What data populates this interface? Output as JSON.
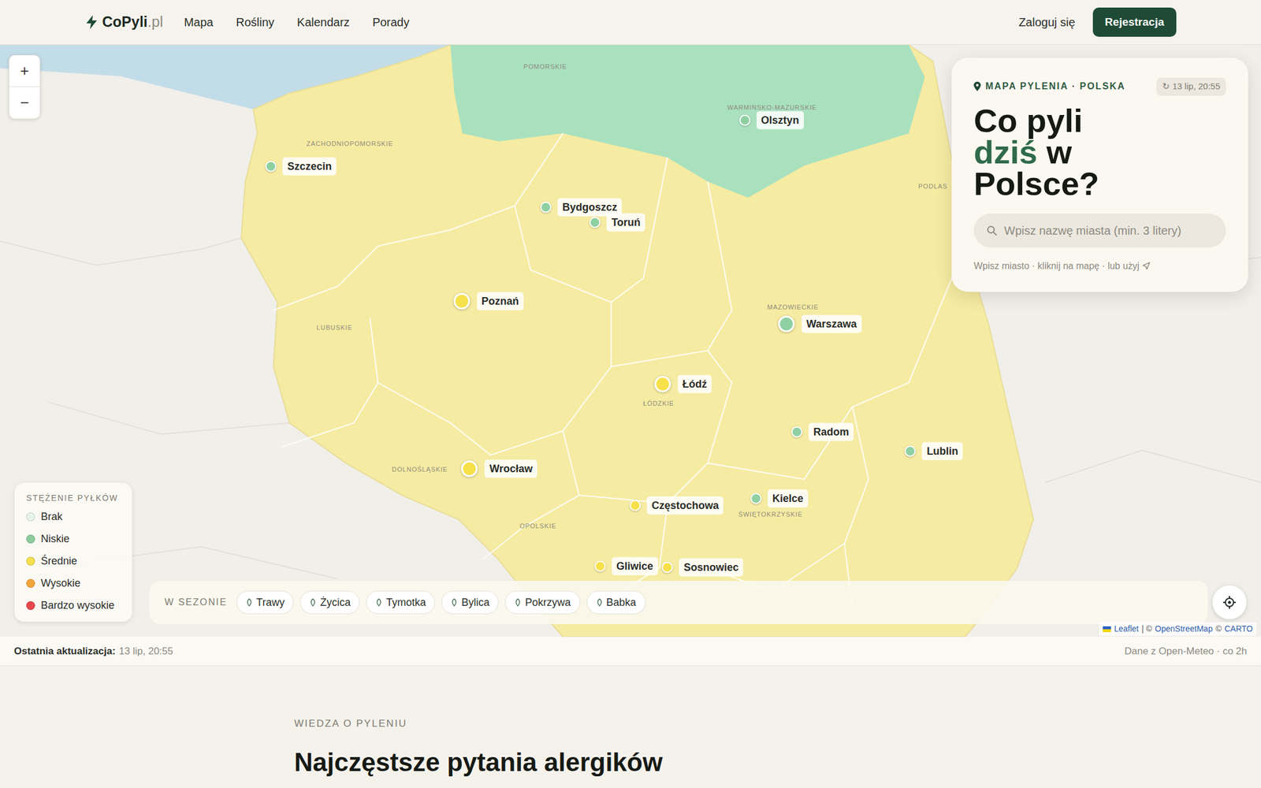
{
  "header": {
    "logo": {
      "name": "CoPyli",
      "suffix": ".pl"
    },
    "nav": [
      {
        "label": "Mapa"
      },
      {
        "label": "Rośliny"
      },
      {
        "label": "Kalendarz"
      },
      {
        "label": "Porady"
      }
    ],
    "login": "Zaloguj się",
    "register": "Rejestracja"
  },
  "map": {
    "zoom_in": "+",
    "zoom_out": "−",
    "areas": [
      {
        "concentration": "Średnie",
        "color": "#f6eba2"
      },
      {
        "concentration": "Niskie",
        "color": "#a9e1bf"
      }
    ],
    "regions": [
      {
        "label": "POMORSKIE"
      },
      {
        "label": "WARMIŃSKO-MAZURSKIE"
      },
      {
        "label": "ZACHODNIOPOMORSKIE"
      },
      {
        "label": "LUBUSKIE"
      },
      {
        "label": "MAZOWIECKIE"
      },
      {
        "label": "ŁÓDZKIE"
      },
      {
        "label": "DOLNOŚLĄSKIE"
      },
      {
        "label": "OPOLSKIE"
      },
      {
        "label": "ŚWIĘTOKRZYSKIE"
      },
      {
        "label": "PODLAS"
      }
    ],
    "cities": [
      {
        "name": "Szczecin",
        "concentration": "Niskie",
        "color": "#8fd0a2",
        "major": false
      },
      {
        "name": "Olsztyn",
        "concentration": "Niskie",
        "color": "#8fd0a2",
        "major": false
      },
      {
        "name": "Bydgoszcz",
        "concentration": "Niskie",
        "color": "#8fd0a2",
        "major": false
      },
      {
        "name": "Toruń",
        "concentration": "Niskie",
        "color": "#8fd0a2",
        "major": false
      },
      {
        "name": "Poznań",
        "concentration": "Średnie",
        "color": "#f7e14b",
        "major": true
      },
      {
        "name": "Warszawa",
        "concentration": "Niskie",
        "color": "#8fd0a2",
        "major": true
      },
      {
        "name": "Łódź",
        "concentration": "Średnie",
        "color": "#f7e14b",
        "major": true
      },
      {
        "name": "Radom",
        "concentration": "Niskie",
        "color": "#8fd0a2",
        "major": false
      },
      {
        "name": "Lublin",
        "concentration": "Niskie",
        "color": "#8fd0a2",
        "major": false
      },
      {
        "name": "Wrocław",
        "concentration": "Średnie",
        "color": "#f7e14b",
        "major": true
      },
      {
        "name": "Częstochowa",
        "concentration": "Średnie",
        "color": "#f7e14b",
        "major": false
      },
      {
        "name": "Kielce",
        "concentration": "Niskie",
        "color": "#8fd0a2",
        "major": false
      },
      {
        "name": "Gliwice",
        "concentration": "Średnie",
        "color": "#f7e14b",
        "major": false
      },
      {
        "name": "Sosnowiec",
        "concentration": "Średnie",
        "color": "#f7e14b",
        "major": false
      }
    ],
    "attribution": {
      "leaflet": "Leaflet",
      "sep": "| ©",
      "osm": "OpenStreetMap",
      "sep2": "©",
      "carto": "CARTO"
    }
  },
  "panel": {
    "eyebrow": "MAPA PYLENIA · POLSKA",
    "refresh_icon": "↻",
    "updated": "13 lip, 20:55",
    "heading": [
      [
        {
          "text": "Co pyli",
          "accent": false
        }
      ],
      [
        {
          "text": "dziś",
          "accent": true
        },
        {
          "text": "w",
          "accent": false
        }
      ],
      [
        {
          "text": "Polsce?",
          "accent": false
        }
      ]
    ],
    "search": {
      "placeholder": "Wpisz nazwę miasta (min. 3 litery)"
    },
    "hint": "Wpisz miasto · kliknij na mapę · lub użyj"
  },
  "legend": {
    "title": "STĘŻENIE PYŁKÓW",
    "items": [
      {
        "label": "Brak",
        "color": "#e6f4ea"
      },
      {
        "label": "Niskie",
        "color": "#8ccc9c"
      },
      {
        "label": "Średnie",
        "color": "#f4e04d"
      },
      {
        "label": "Wysokie",
        "color": "#f2a53a"
      },
      {
        "label": "Bardzo wysokie",
        "color": "#e5484d"
      }
    ]
  },
  "season": {
    "label": "W SEZONIE",
    "plants": [
      {
        "name": "Trawy"
      },
      {
        "name": "Życica"
      },
      {
        "name": "Tymotka"
      },
      {
        "name": "Bylica"
      },
      {
        "name": "Pokrzywa"
      },
      {
        "name": "Babka"
      }
    ]
  },
  "status_bar": {
    "label": "Ostatnia aktualizacja:",
    "time": "13 lip, 20:55",
    "source": "Dane z Open-Meteo · co 2h"
  },
  "faq": {
    "eyebrow": "WIEDZA O PYLENIU",
    "title": "Najczęstsze pytania alergików"
  }
}
